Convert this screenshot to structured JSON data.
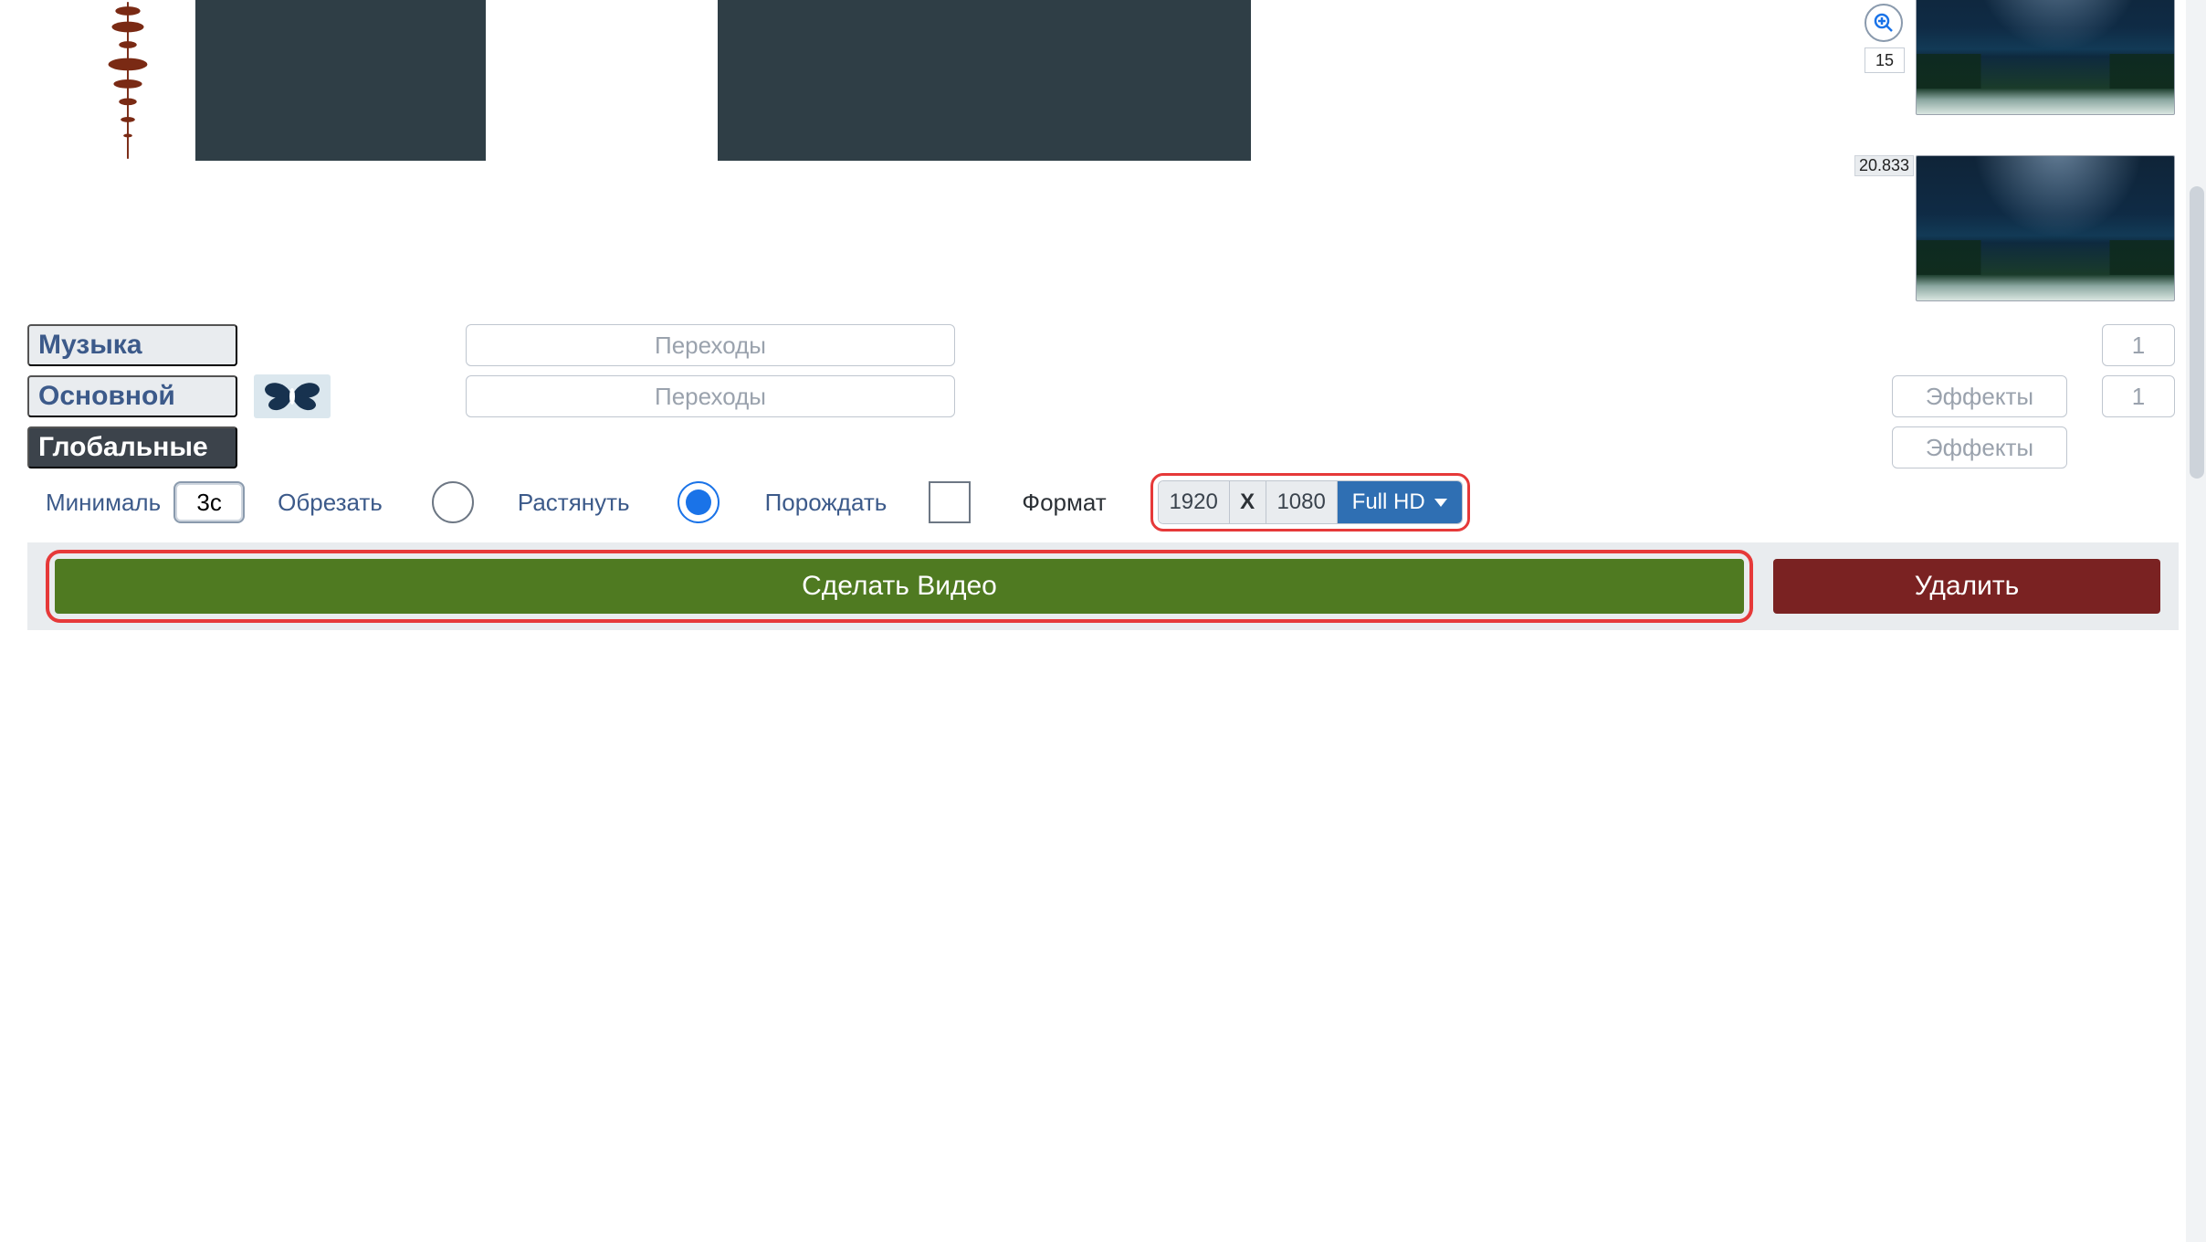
{
  "zoom": {
    "label": "15"
  },
  "timeline": {
    "clip_timestamp": "20.833"
  },
  "lanes": {
    "music": "Музыка",
    "main": "Основной",
    "global": "Глобальные"
  },
  "row1": {
    "transitions_label": "Переходы",
    "count": "1"
  },
  "row2": {
    "transitions_label": "Переходы",
    "effects_label": "Эффекты",
    "count": "1"
  },
  "row3": {
    "effects_label": "Эффекты"
  },
  "options": {
    "minimal_label": "Минималь",
    "minimal_value": "3с",
    "crop_label": "Обрезать",
    "stretch_label": "Растянуть",
    "spawn_label": "Порождать",
    "format_label": "Формат",
    "width": "1920",
    "x": "X",
    "height": "1080",
    "preset_label": "Full HD"
  },
  "actions": {
    "make_video": "Сделать Видео",
    "delete": "Удалить"
  }
}
